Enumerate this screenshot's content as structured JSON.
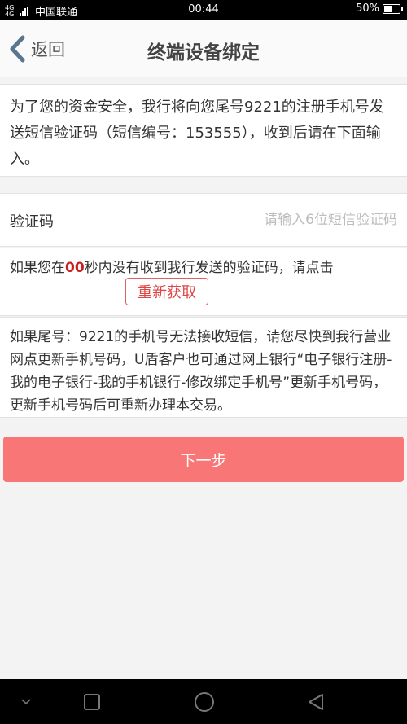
{
  "status_bar": {
    "network": "4G 4G",
    "carrier": "中国联通",
    "time": "00:44",
    "battery_percent": "50%",
    "battery_level": 0.5
  },
  "header": {
    "back_label": "返回",
    "title": "终端设备绑定"
  },
  "notice": {
    "text": "为了您的资金安全，我行将向您尾号9221的注册手机号发送短信验证码（短信编号：153555），收到后请在下面输入。"
  },
  "verify": {
    "label": "验证码",
    "value": "",
    "placeholder": "请输入6位短信验证码"
  },
  "resend": {
    "prefix": "如果您在",
    "seconds": "00",
    "suffix": "秒内没有收到我行发送的验证码，请点击",
    "button_label": "重新获取"
  },
  "help": {
    "text": "如果尾号：9221的手机号无法接收短信，请您尽快到我行营业网点更新手机号码，U盾客户也可通过网上银行“电子银行注册-我的电子银行-我的手机银行-修改绑定手机号”更新手机号码，更新手机号码后可重新办理本交易。"
  },
  "actions": {
    "next_label": "下一步"
  },
  "colors": {
    "primary_button": "#f87676",
    "countdown": "#c81e1e",
    "resend_border": "#e06060"
  }
}
